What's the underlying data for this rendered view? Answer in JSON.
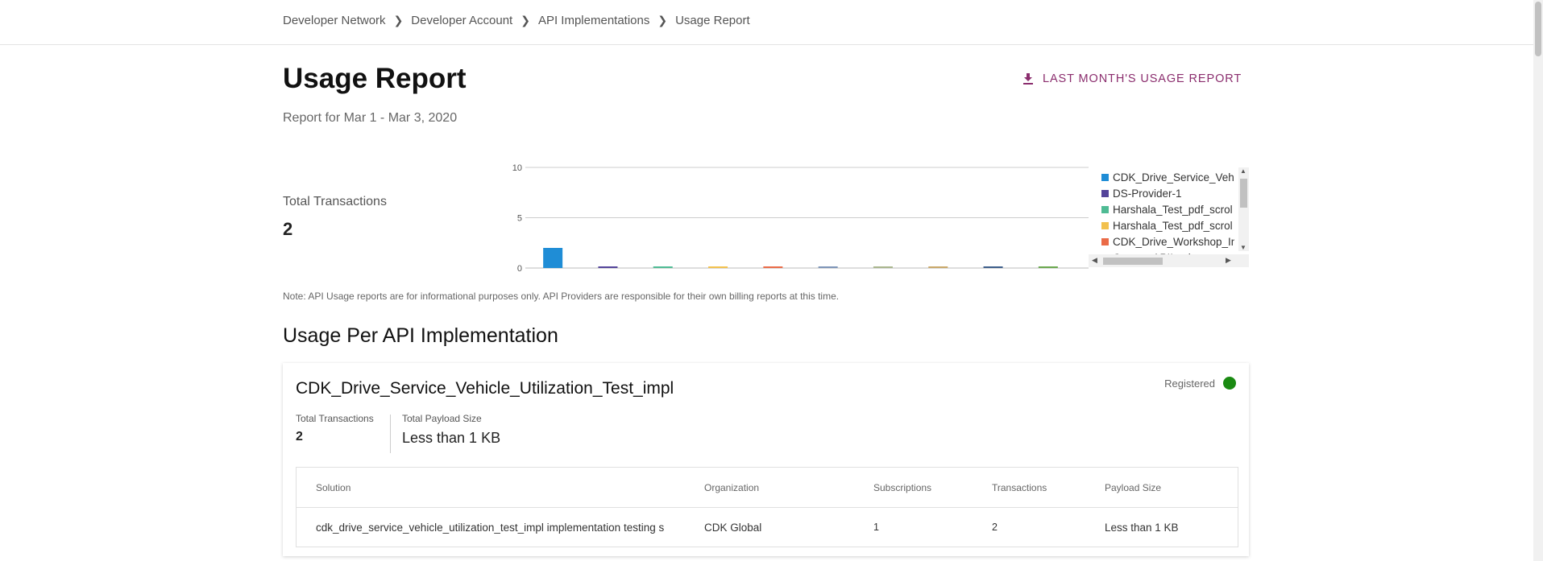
{
  "breadcrumb": {
    "items": [
      "Developer Network",
      "Developer Account",
      "API Implementations",
      "Usage Report"
    ]
  },
  "header": {
    "title": "Usage Report",
    "report_range": "Report for Mar 1 - Mar 3, 2020",
    "download_label": "LAST MONTH'S USAGE REPORT"
  },
  "summary": {
    "total_label": "Total Transactions",
    "total_value": "2"
  },
  "chart_data": {
    "type": "bar",
    "ylim": [
      0,
      10
    ],
    "yticks": [
      "0",
      "5",
      "10"
    ],
    "grid": true,
    "legend_position": "right",
    "series": [
      {
        "name": "CDK_Drive_Service_Vehicle_Utilization_Test_impl",
        "value": 2,
        "color": "#1f8dd6"
      },
      {
        "name": "DS-Provider-1",
        "value": 0,
        "color": "#54449a"
      },
      {
        "name": "Harshala_Test_pdf_scrol",
        "value": 0,
        "color": "#4fbb94"
      },
      {
        "name": "Harshala_Test_pdf_scrol",
        "value": 0,
        "color": "#f2c14e"
      },
      {
        "name": "CDK_Drive_Workshop_In",
        "value": 0,
        "color": "#ea6b47"
      },
      {
        "name": "CypressAPIImplementa",
        "value": 0,
        "color": "#7d95b8"
      },
      {
        "name": "",
        "value": 0,
        "color": "#a9b68d"
      },
      {
        "name": "",
        "value": 0,
        "color": "#c9a869"
      },
      {
        "name": "",
        "value": 0,
        "color": "#3d5e8a"
      },
      {
        "name": "",
        "value": 0,
        "color": "#6aa84f"
      }
    ]
  },
  "legend": {
    "visible": [
      "CDK_Drive_Service_Vehi",
      "DS-Provider-1",
      "Harshala_Test_pdf_scrol",
      "Harshala_Test_pdf_scrol",
      "CDK_Drive_Workshop_In",
      "CypressAPIImplementa"
    ]
  },
  "note": "Note: API Usage reports are for informational purposes only. API Providers are responsible for their own billing reports at this time.",
  "section_title": "Usage Per API Implementation",
  "card": {
    "title": "CDK_Drive_Service_Vehicle_Utilization_Test_impl",
    "status": "Registered",
    "status_color": "#1a8a12",
    "metrics": {
      "transactions_label": "Total Transactions",
      "transactions_value": "2",
      "payload_label": "Total Payload Size",
      "payload_value": "Less than 1 KB"
    },
    "table": {
      "headers": [
        "Solution",
        "Organization",
        "Subscriptions",
        "Transactions",
        "Payload Size"
      ],
      "rows": [
        [
          "cdk_drive_service_vehicle_utilization_test_impl implementation testing s",
          "CDK Global",
          "1",
          "2",
          "Less than 1 KB"
        ]
      ]
    }
  },
  "colors": {
    "accent": "#8b2e6e",
    "bar_primary": "#1f8dd6"
  }
}
